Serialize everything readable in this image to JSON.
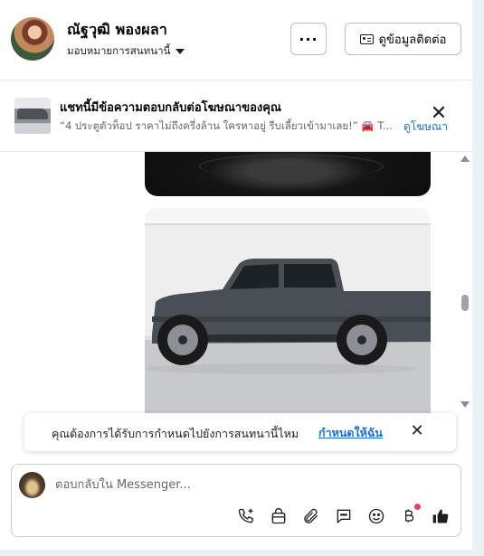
{
  "header": {
    "contact_name": "ณัฐวุฒิ พองผลา",
    "assign_label": "มอบหมายการสนทนานี้",
    "more_label": "···",
    "profile_button_label": "ดูข้อมูลติดต่อ"
  },
  "ad_banner": {
    "title": "แชทนี้มีข้อความตอบกลับต่อโฆษณาของคุณ",
    "quote": "“4 ประตูตัวท็อป ราคาไม่ถึงครึ่งล้าน ใครหาอยู่ รีบเลี้ยวเข้ามาเลย!” 🚘 T...",
    "view_ad_link": "ดูโฆษณา",
    "close_symbol": "✕"
  },
  "assign_prompt": {
    "text": "คุณต้องการได้รับการกำหนดไปยังการสนทนานี้ไหม",
    "link": "กำหนดให้ฉัน",
    "close_symbol": "✕"
  },
  "composer": {
    "placeholder": "ตอบกลับใน Messenger...",
    "tools": [
      "call-add-icon",
      "shopping-bag-icon",
      "paperclip-icon",
      "chat-bubble-icon",
      "emoji-icon",
      "baht-icon",
      "like-icon"
    ]
  },
  "colors": {
    "link_blue": "#1a6fd6",
    "notification_dot": "#e4405f",
    "background": "#e9f3f4"
  }
}
